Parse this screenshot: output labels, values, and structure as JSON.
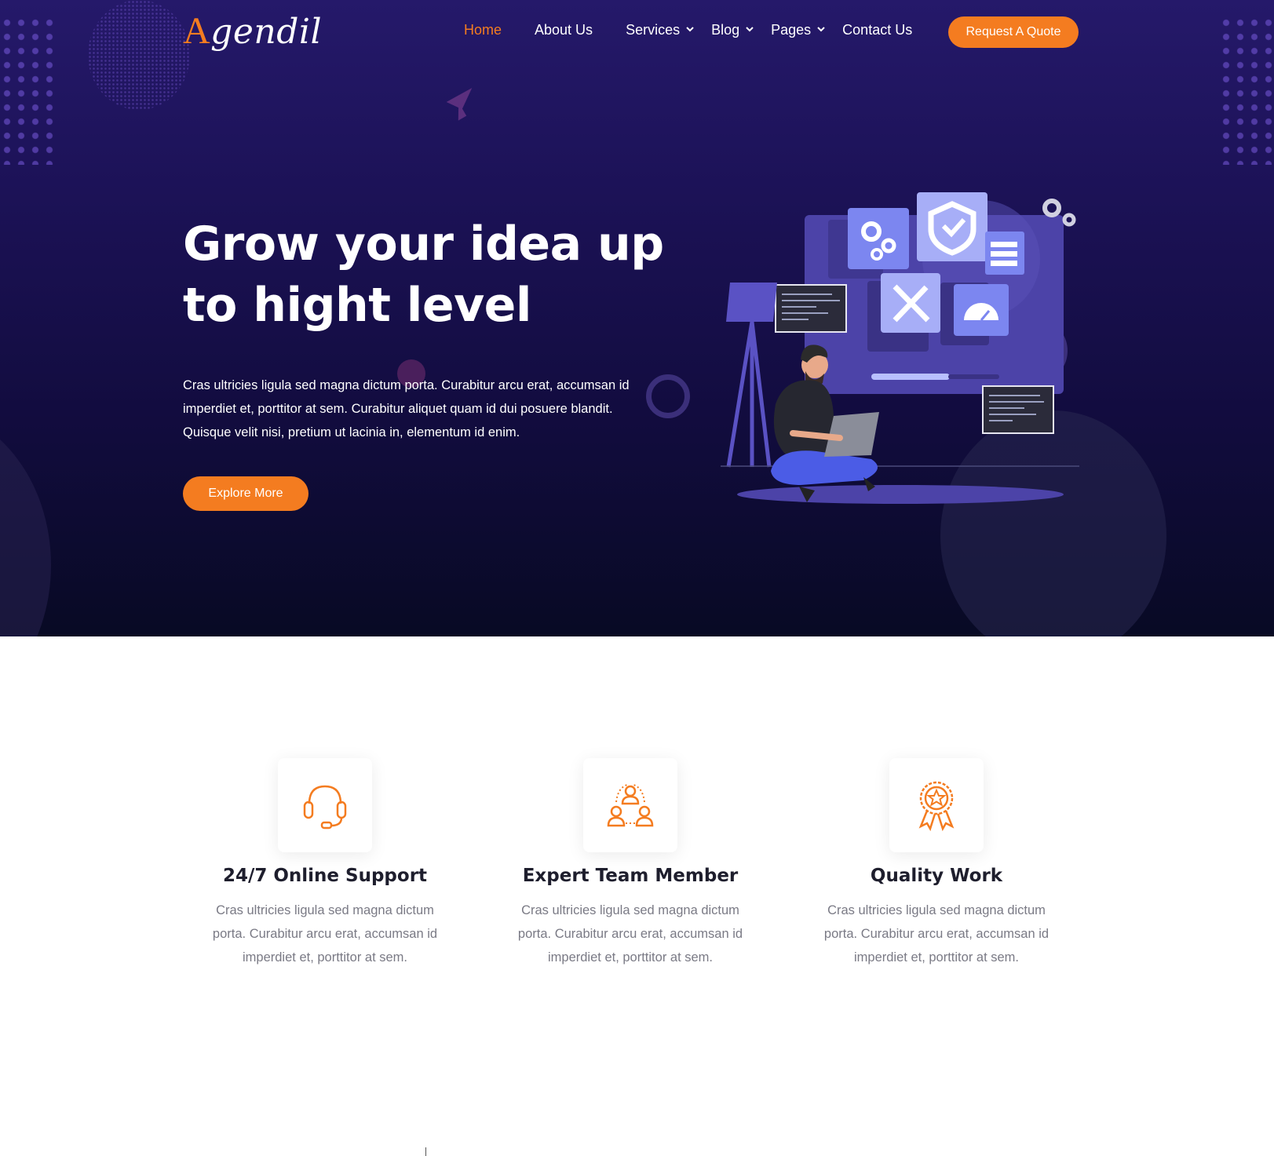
{
  "logo": {
    "first_letter": "A",
    "rest": "gendil"
  },
  "nav": {
    "items": [
      {
        "label": "Home",
        "active": true
      },
      {
        "label": "About Us"
      },
      {
        "label": "Services",
        "dropdown": true
      },
      {
        "label": "Blog",
        "dropdown": true
      },
      {
        "label": "Pages",
        "dropdown": true
      },
      {
        "label": "Contact Us"
      }
    ],
    "cta_label": "Request A Quote"
  },
  "hero": {
    "title_line1": "Grow your idea up",
    "title_line2": "to hight level",
    "text": "Cras ultricies ligula sed magna dictum porta. Curabitur arcu erat, accumsan id imperdiet et, porttitor at sem. Curabitur aliquet quam id dui posuere blandit. Quisque velit nisi, pretium ut lacinia in, elementum id enim.",
    "button_label": "Explore More"
  },
  "features": [
    {
      "icon": "headset-icon",
      "title": "24/7 Online Support",
      "text": "Cras ultricies ligula sed magna dictum porta. Curabitur arcu erat, accumsan id imperdiet et, porttitor at sem."
    },
    {
      "icon": "team-icon",
      "title": "Expert Team Member",
      "text": "Cras ultricies ligula sed magna dictum porta. Curabitur arcu erat, accumsan id imperdiet et, porttitor at sem."
    },
    {
      "icon": "award-icon",
      "title": "Quality Work",
      "text": "Cras ultricies ligula sed magna dictum porta. Curabitur arcu erat, accumsan id imperdiet et, porttitor at sem."
    }
  ],
  "colors": {
    "accent": "#f47c20",
    "hero_top": "#25196a",
    "hero_bottom": "#080a24",
    "heading": "#1e1e2d",
    "body_text": "#7a7a85"
  }
}
